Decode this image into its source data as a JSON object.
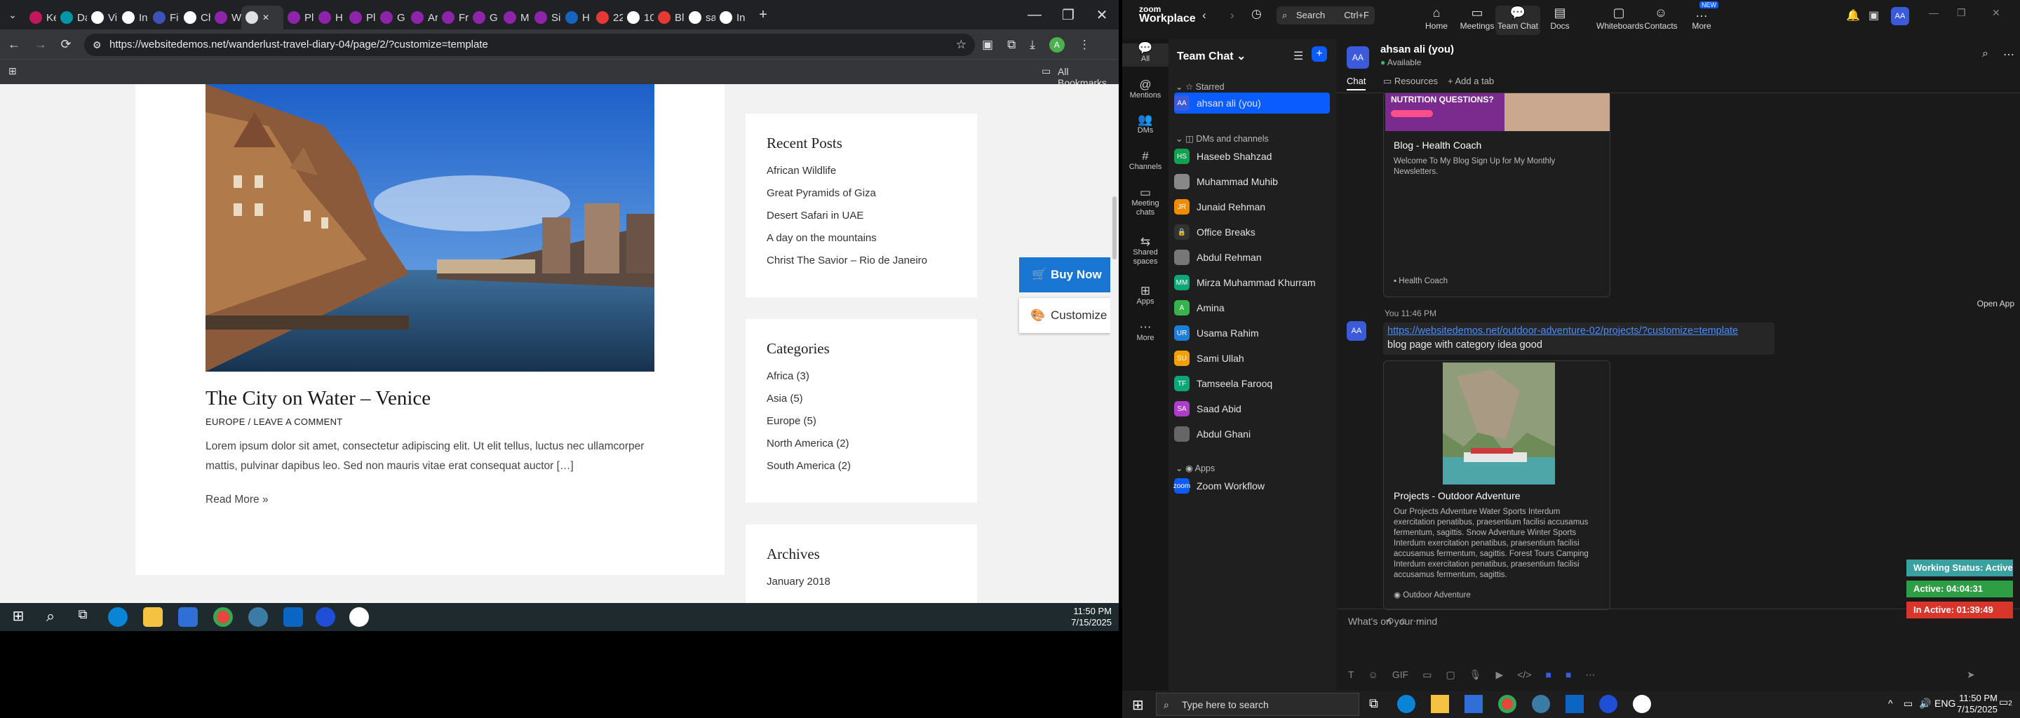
{
  "browser": {
    "tabs": [
      {
        "label": "Ke",
        "color": "#c2185b"
      },
      {
        "label": "Da",
        "color": "#0097a7"
      },
      {
        "label": "Vi",
        "color": "#fff"
      },
      {
        "label": "In",
        "color": "#fff"
      },
      {
        "label": "Fi",
        "color": "#3f51b5"
      },
      {
        "label": "Ch",
        "color": "#fff"
      },
      {
        "label": "W",
        "color": "#8e24aa"
      },
      {
        "label": "",
        "color": "#e0e0e0",
        "active": true
      },
      {
        "label": "Pl",
        "color": "#8e24aa"
      },
      {
        "label": "H",
        "color": "#8e24aa"
      },
      {
        "label": "Pl",
        "color": "#8e24aa"
      },
      {
        "label": "G",
        "color": "#8e24aa"
      },
      {
        "label": "Ar",
        "color": "#8e24aa"
      },
      {
        "label": "Fr",
        "color": "#8e24aa"
      },
      {
        "label": "G",
        "color": "#8e24aa"
      },
      {
        "label": "M",
        "color": "#8e24aa"
      },
      {
        "label": "Si",
        "color": "#8e24aa"
      },
      {
        "label": "H",
        "color": "#1565c0"
      },
      {
        "label": "22",
        "color": "#e53935"
      },
      {
        "label": "10",
        "color": "#fff"
      },
      {
        "label": "Bl",
        "color": "#e53935"
      },
      {
        "label": "sa",
        "color": "#fff"
      },
      {
        "label": "In",
        "color": "#fff"
      }
    ],
    "url": "https://websitedemos.net/wanderlust-travel-diary-04/page/2/?customize=template",
    "bookmarks_label": "All Bookmarks",
    "profile_initial": "A"
  },
  "website": {
    "post": {
      "title": "The City on Water – Venice",
      "meta": "EUROPE / LEAVE A COMMENT",
      "excerpt": "Lorem ipsum dolor sit amet, consectetur adipiscing elit. Ut elit tellus, luctus nec ullamcorper mattis, pulvinar dapibus leo. Sed non mauris vitae erat consequat auctor […]",
      "read_more": "Read More »"
    },
    "recent_posts": {
      "title": "Recent Posts",
      "items": [
        "African Wildlife",
        "Great Pyramids of Giza",
        "Desert Safari in UAE",
        "A day on the mountains",
        "Christ The Savior – Rio de Janeiro"
      ]
    },
    "categories": {
      "title": "Categories",
      "items": [
        "Africa (3)",
        "Asia (5)",
        "Europe (5)",
        "North America (2)",
        "South America (2)"
      ]
    },
    "archives": {
      "title": "Archives",
      "items": [
        "January 2018"
      ]
    },
    "buy_now": "Buy Now",
    "customize": "Customize"
  },
  "left_taskbar": {
    "time": "11:50 PM",
    "date": "7/15/2025"
  },
  "zoom": {
    "brand_top": "zoom",
    "brand_bottom": "Workplace",
    "search": "Search",
    "search_shortcut": "Ctrl+F",
    "nav": [
      {
        "label": "Home",
        "icon": "⌂"
      },
      {
        "label": "Meetings",
        "icon": "▭"
      },
      {
        "label": "Team Chat",
        "icon": "💬",
        "selected": true
      },
      {
        "label": "Docs",
        "icon": "▤"
      },
      {
        "label": "Whiteboards",
        "icon": "▢"
      },
      {
        "label": "Contacts",
        "icon": "☺"
      },
      {
        "label": "More",
        "icon": "…",
        "badge": "NEW"
      }
    ],
    "rail": [
      {
        "label": "All",
        "icon": "💬"
      },
      {
        "label": "Mentions",
        "icon": "@"
      },
      {
        "label": "DMs",
        "icon": "👥"
      },
      {
        "label": "Channels",
        "icon": "#"
      },
      {
        "label": "Meeting chats",
        "icon": "▭"
      },
      {
        "label": "Shared spaces",
        "icon": "⇆"
      },
      {
        "label": "Apps",
        "icon": "⊞"
      },
      {
        "label": "More",
        "icon": "⋯"
      }
    ],
    "panel_title": "Team Chat",
    "starred_label": "Starred",
    "starred": [
      {
        "name": "ahsan ali (you)",
        "initials": "AA",
        "color": "#3b5bdb"
      }
    ],
    "dms_label": "DMs and channels",
    "dms": [
      {
        "name": "Haseeb Shahzad",
        "initials": "HS",
        "color": "#12a150"
      },
      {
        "name": "Muhammad Muhib",
        "initials": "",
        "color": "#888"
      },
      {
        "name": "Junaid Rehman",
        "initials": "JR",
        "color": "#f08c00"
      },
      {
        "name": "Office Breaks",
        "initials": "🔒",
        "color": "#333"
      },
      {
        "name": "Abdul Rehman",
        "initials": "",
        "color": "#777"
      },
      {
        "name": "Mirza Muhammad Khurram",
        "initials": "MM",
        "color": "#0ca678"
      },
      {
        "name": "Amina",
        "initials": "A",
        "color": "#37b24d"
      },
      {
        "name": "Usama Rahim",
        "initials": "UR",
        "color": "#1c7ed6"
      },
      {
        "name": "Sami Ullah",
        "initials": "SU",
        "color": "#f59f00"
      },
      {
        "name": "Tamseela Farooq",
        "initials": "TF",
        "color": "#0ca678"
      },
      {
        "name": "Saad Abid",
        "initials": "SA",
        "color": "#ae3ec9"
      },
      {
        "name": "Abdul Ghani",
        "initials": "",
        "color": "#666"
      }
    ],
    "apps_label": "Apps",
    "apps": [
      {
        "name": "Zoom Workflow",
        "initials": "zoom",
        "color": "#0b5cff"
      }
    ],
    "chat": {
      "user_initials": "AA",
      "user_name": "ahsan ali (you)",
      "status": "Available",
      "tabs": [
        "Chat",
        "Resources",
        "Add a tab"
      ],
      "card1": {
        "title": "Blog - Health Coach",
        "desc": "Welcome To My Blog Sign Up for My Monthly Newsletters.",
        "footer": "Health Coach",
        "image_text": "NUTRITION QUESTIONS?"
      },
      "msg_time": "You 11:46 PM",
      "link": "https://websitedemos.net/outdoor-adventure-02/projects/?customize=template",
      "msg_text": "blog page with category idea good",
      "card2": {
        "title": "Projects - Outdoor Adventure",
        "desc": "Our Projects Adventure Water Sports Interdum exercitation penatibus, praesentium facilisi accusamus fermentum, sagittis. Snow Adventure Winter Sports Interdum exercitation penatibus, praesentium facilisi accusamus fermentum, sagittis. Forest Tours Camping Interdum exercitation penatibus, praesentium facilisi accusamus fermentum, sagittis.",
        "footer": "Outdoor Adventure"
      },
      "composer_placeholder": "What's on your mind",
      "open_app": "Open App"
    }
  },
  "status_overlay": {
    "working": "Working Status: Active",
    "active": "Active: 04:04:31",
    "inactive": "In Active: 01:39:49",
    "colors": {
      "working": "#3aa0a0",
      "active": "#2e9e44",
      "inactive": "#d9362b"
    }
  },
  "right_taskbar": {
    "search_placeholder": "Type here to search",
    "time": "11:50 PM",
    "date": "7/15/2025",
    "notif_count": "2"
  }
}
